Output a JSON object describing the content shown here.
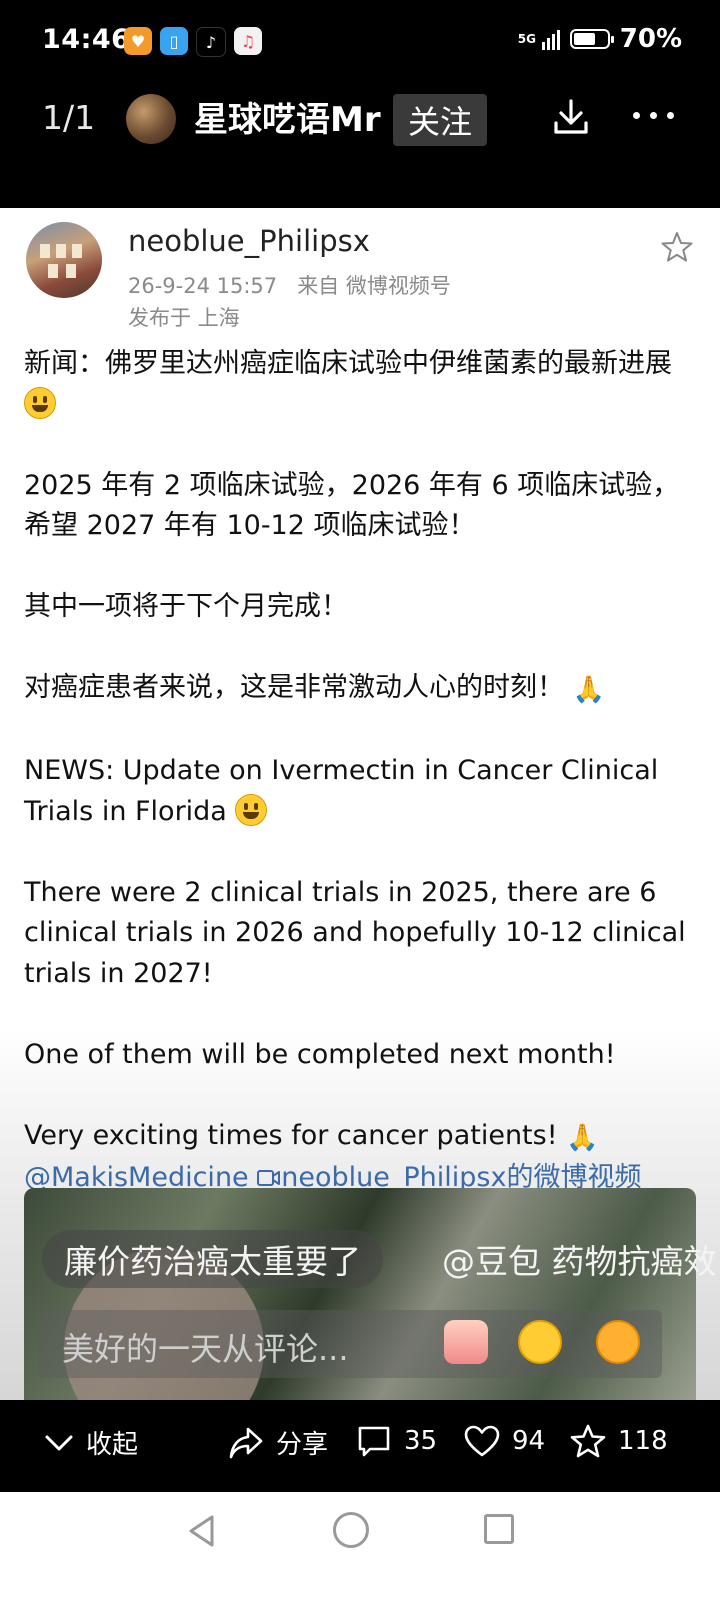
{
  "status_bar": {
    "time": "14:46",
    "network": "5G",
    "battery_text": "70%",
    "battery_level": 0.7,
    "app_icons": [
      "weibo-heart-icon",
      "reader-icon",
      "tiktok-icon",
      "music-icon"
    ]
  },
  "header": {
    "pager": "1/1",
    "username": "星球呓语Mr",
    "follow_label": "关注"
  },
  "post": {
    "author": "neoblue_Philipsx",
    "date": "26-9-24 15:57",
    "source_prefix": "来自",
    "source": "微博视频号",
    "location": "发布于 上海",
    "paragraphs": [
      "新闻：佛罗里达州癌症临床试验中伊维菌素的最新进展",
      "2025 年有 2 项临床试验，2026 年有 6 项临床试验，希望 2027 年有 10-12 项临床试验！",
      "其中一项将于下个月完成！",
      "对癌症患者来说，这是非常激动人心的时刻！",
      "NEWS: Update on Ivermectin in Cancer Clinical Trials in Florida",
      "There were 2 clinical trials in 2025, there are 6 clinical trials in 2026 and hopefully 10-12 clinical trials in 2027!",
      "One of them will be completed next month!",
      "Very exciting times for cancer patients!"
    ],
    "mention": "@MakisMedicine",
    "video_link": "neoblue_Philipsx的微博视频"
  },
  "overlay": {
    "danmaku": [
      "廉价药治癌太重要了",
      "@豆包 药物抗癌效"
    ],
    "comment_placeholder": "美好的一天从评论..."
  },
  "actions": {
    "collapse": "收起",
    "share": "分享",
    "comments": "35",
    "likes": "94",
    "favorites": "118"
  }
}
